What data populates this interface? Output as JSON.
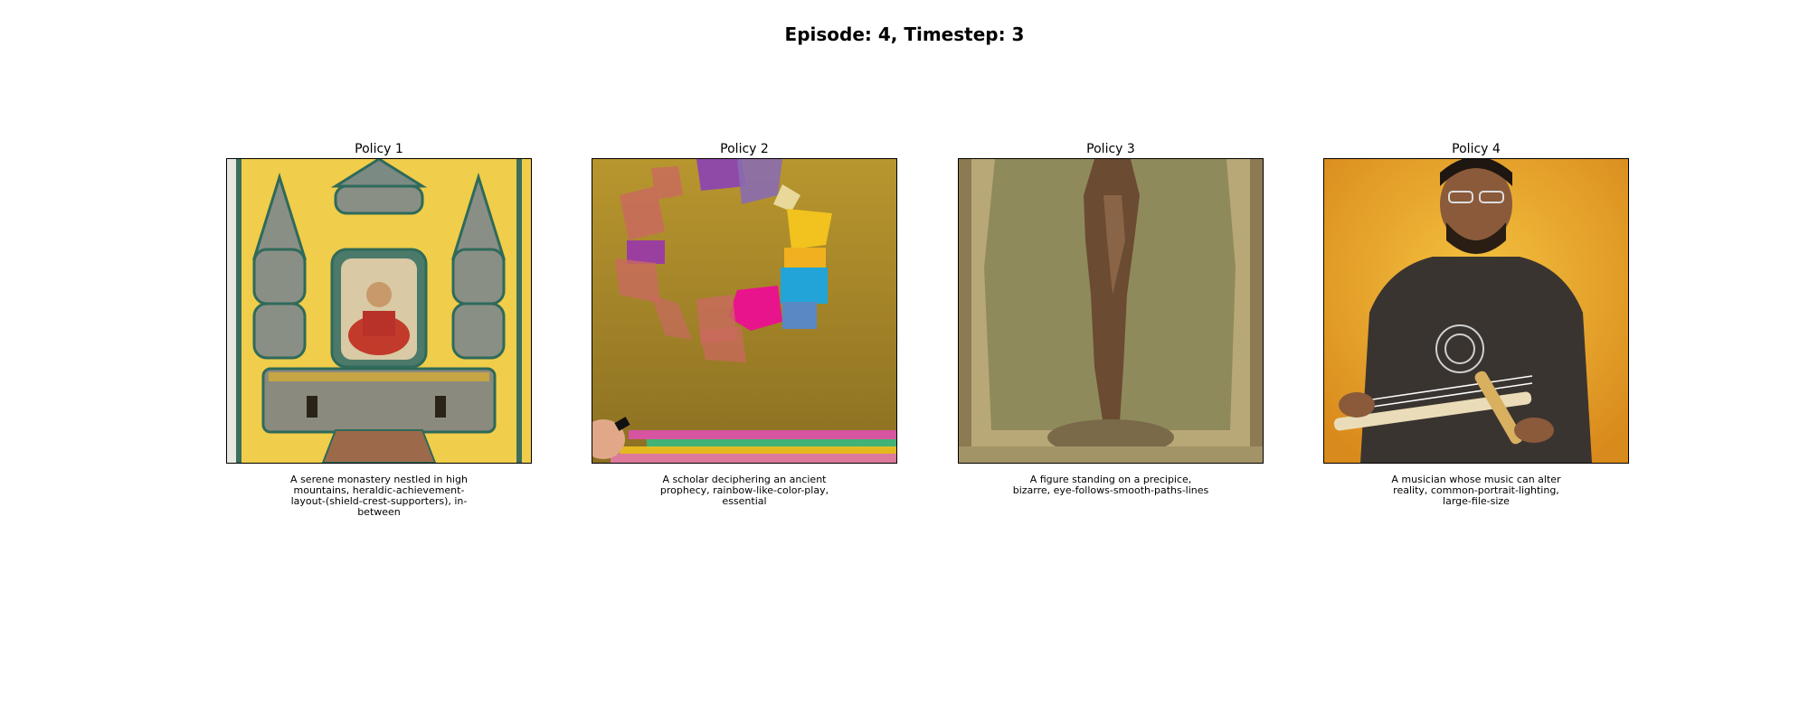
{
  "title": "Episode: 4, Timestep: 3",
  "panels": [
    {
      "title": "Policy 1",
      "caption": "A serene monastery nestled in high mountains, heraldic-achievement-layout-(shield-crest-supporters), in-between"
    },
    {
      "title": "Policy 2",
      "caption": "A scholar deciphering an ancient prophecy, rainbow-like-color-play, essential"
    },
    {
      "title": "Policy 3",
      "caption": "A figure standing on a precipice, bizarre, eye-follows-smooth-paths-lines"
    },
    {
      "title": "Policy 4",
      "caption": "A musician whose music can alter reality, common-portrait-lighting, large-file-size"
    }
  ]
}
